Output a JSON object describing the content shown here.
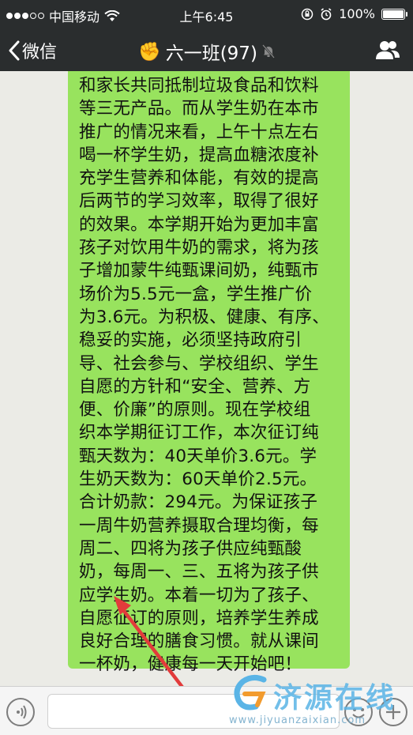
{
  "status_bar": {
    "carrier": "中国移动",
    "time": "上午6:45",
    "battery": "100%"
  },
  "nav": {
    "back_label": "微信",
    "group_emoji": "✊",
    "title": "六一班(97)"
  },
  "message": {
    "lines": [
      "和家长共同抵制垃圾食品和饮料",
      "等三无产品。而从学生奶在本市",
      "推广的情况来看，上午十点左右",
      "喝一杯学生奶，提高血糖浓度补",
      "充学生营养和体能，有效的提高",
      "后两节的学习效率，取得了很好",
      "的效果。本学期开始为更加丰富",
      "孩子对饮用牛奶的需求，将为孩",
      "子增加蒙牛纯甄课间奶，纯甄市",
      "场价为5.5元一盒，学生推广价",
      "为3.6元。为积极、健康、有序、",
      "稳妥的实施，必须坚持政府引",
      "导、社会参与、学校组织、学生",
      "自愿的方针和“安全、营养、方",
      "便、价廉”的原则。现在学校组",
      "织本学期征订工作，本次征订纯",
      "甄天数为：40天单价3.6元。学",
      "生奶天数为：60天单价2.5元。",
      "合计奶款：294元。为保证孩子",
      "一周牛奶营养摄取合理均衡，每",
      "周二、四将为孩子供应纯甄酸",
      "奶，每周一、三、五将为孩子供",
      "应学生奶。本着一切为了孩子、",
      "自愿征订的原则，培养学生养成",
      "良好合理的膳食习惯。就从课间",
      "一杯奶，健康每一天开始吧！"
    ]
  },
  "watermark": {
    "text": "济源在线",
    "url": "www.jiyuanzaixian.com"
  },
  "colors": {
    "nav_bg": "#2a2d2e",
    "bubble": "#98e35e",
    "arrow": "#e23b3b"
  }
}
